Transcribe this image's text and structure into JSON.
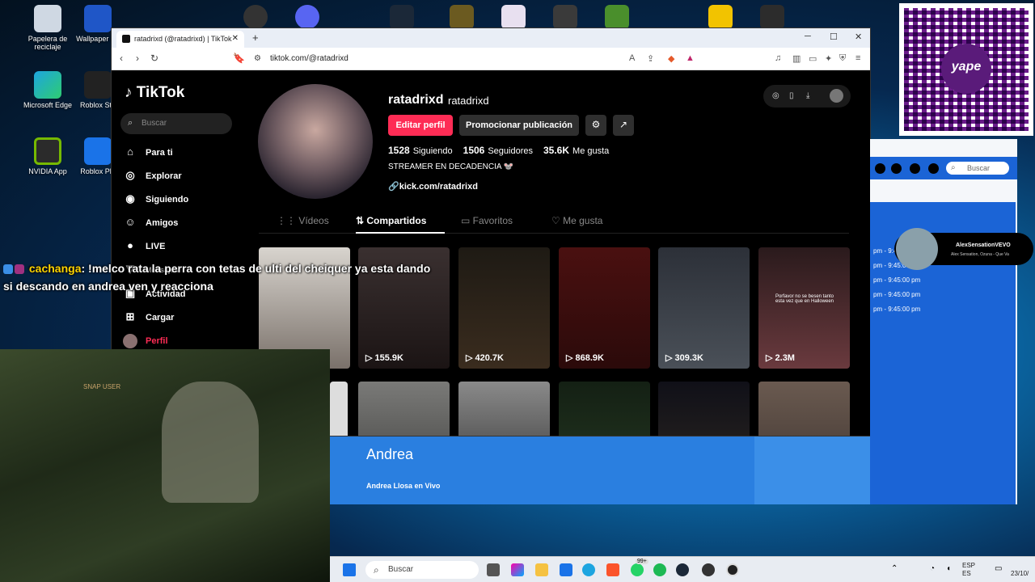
{
  "desktop": {
    "icons": [
      {
        "label": "Papelera de reciclaje"
      },
      {
        "label": "Wallpaper En"
      },
      {
        "label": "Microsoft Edge"
      },
      {
        "label": "Roblox Stu"
      },
      {
        "label": "NVIDIA App"
      },
      {
        "label": "Roblox Pla"
      }
    ]
  },
  "browser": {
    "tab_title": "ratadrixd (@ratadrixd) | TikTok",
    "new_tab": "+",
    "url": "tiktok.com/@ratadrixd",
    "win_min": "─",
    "win_max": "☐",
    "win_close": "✕"
  },
  "tiktok": {
    "logo": "TikTok",
    "search_placeholder": "Buscar",
    "nav": [
      {
        "label": "Para ti",
        "icon": "home-icon"
      },
      {
        "label": "Explorar",
        "icon": "compass-icon"
      },
      {
        "label": "Siguiendo",
        "icon": "following-icon"
      },
      {
        "label": "Amigos",
        "icon": "friends-icon"
      },
      {
        "label": "LIVE",
        "icon": "live-icon"
      },
      {
        "label": "Mensajes",
        "icon": "messages-icon"
      },
      {
        "label": "Actividad",
        "icon": "activity-icon"
      },
      {
        "label": "Cargar",
        "icon": "upload-icon"
      },
      {
        "label": "Perfil",
        "icon": "profile-icon"
      }
    ],
    "profile": {
      "username": "ratadrixd",
      "nickname": "ratadrixd",
      "edit_label": "Editar perfil",
      "promo_label": "Promocionar publicación",
      "following_count": "1528",
      "following_label": "Siguiendo",
      "followers_count": "1506",
      "followers_label": "Seguidores",
      "likes_count": "35.6K",
      "likes_label": "Me gusta",
      "bio": "STREAMER EN DECADENCIA 🐭",
      "link": "kick.com/ratadrixd"
    },
    "tabs": [
      {
        "label": "Vídeos"
      },
      {
        "label": "Compartidos"
      },
      {
        "label": "Favoritos"
      },
      {
        "label": "Me gusta"
      }
    ],
    "videos": [
      {
        "views": ""
      },
      {
        "views": "155.9K"
      },
      {
        "views": "420.7K"
      },
      {
        "views": "868.9K"
      },
      {
        "views": "309.3K"
      },
      {
        "views": "2.3M",
        "caption": "Porfavor no se besen tanto esta vez que en Halloween"
      }
    ],
    "accent_color": "#fe2c55"
  },
  "chat": {
    "user": "cachanga",
    "message": ": !melco rata la perra con tetas de ulti del cheiquer ya esta dando si descando en andrea ven y reacciona"
  },
  "webcam": {
    "overlay_text": "SNAP USER"
  },
  "panel": {
    "title": "Andrea",
    "subtitle": "Andrea Llosa en Vivo"
  },
  "rightpanel": {
    "search_placeholder": "Buscar",
    "times": [
      "pm - 9:45:00 pm",
      "pm - 9:45:00 pm",
      "pm - 9:45:00 pm",
      "pm - 9:45:00 pm",
      "pm - 9:45:00 pm",
      "pm - 9:45:00 pm"
    ],
    "singer_name": "AlexSensationVEVO",
    "singer_sub": "Alex Sensation, Ozuna - Que Va",
    "qr_label": "yape"
  },
  "taskbar": {
    "search_placeholder": "Buscar",
    "badge": "99+",
    "lang1": "ESP",
    "lang2": "ES",
    "date": "23/10/"
  }
}
